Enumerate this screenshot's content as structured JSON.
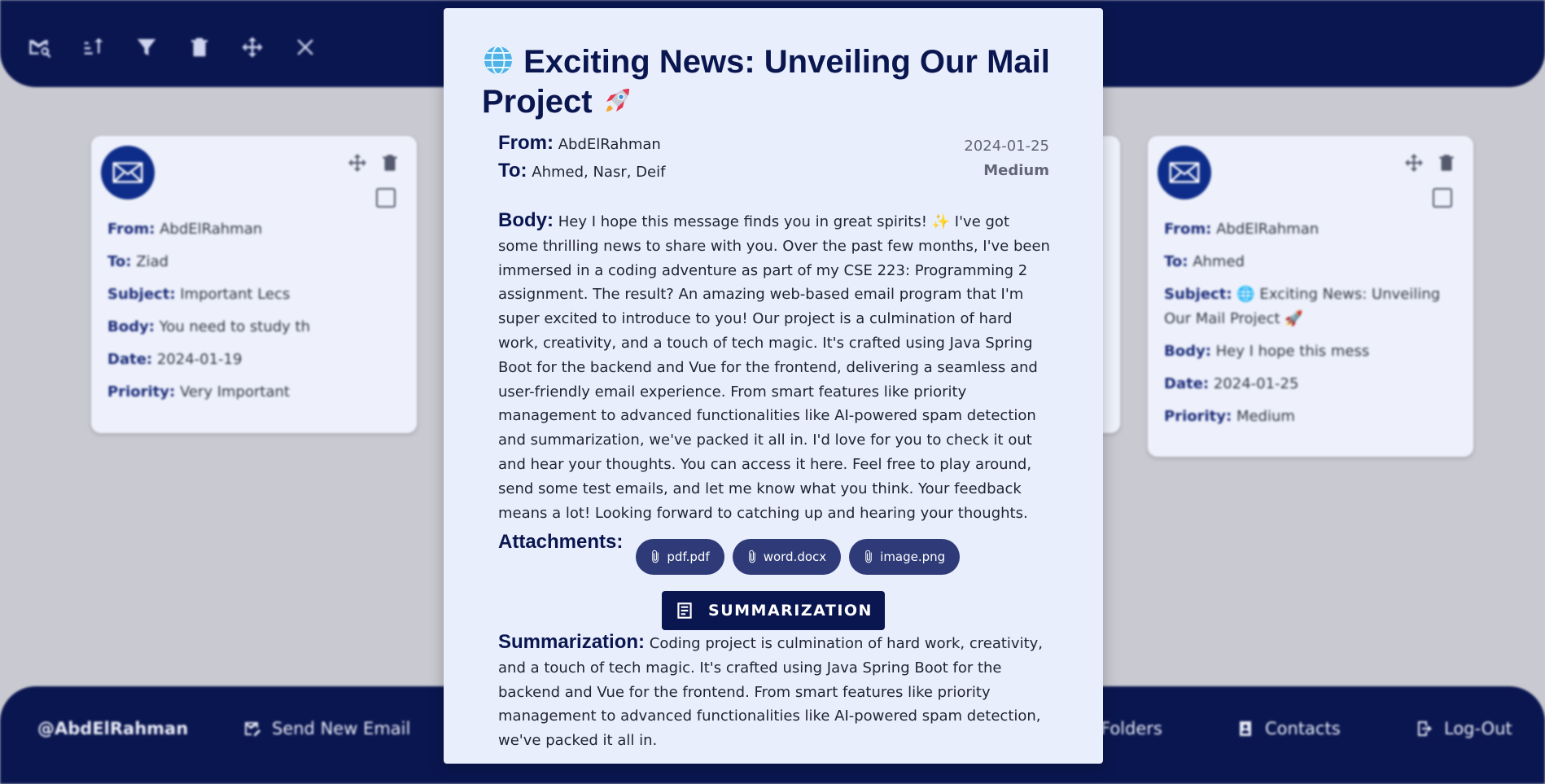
{
  "toolbar": {
    "icons": [
      "search-mail-icon",
      "sort-icon",
      "filter-icon",
      "trash-icon",
      "move-icon",
      "close-icon"
    ]
  },
  "nav": {
    "user": "@AbdElRahman",
    "send_new_email": "Send New Email",
    "folders": "Folders",
    "contacts": "Contacts",
    "logout": "Log-Out"
  },
  "labels": {
    "from": "From:",
    "to": "To:",
    "subject": "Subject:",
    "body": "Body:",
    "date": "Date:",
    "priority": "Priority:",
    "attachments": "Attachments:",
    "summarization": "Summarization:"
  },
  "cards": [
    {
      "from": "AbdElRahman",
      "to": "Ziad",
      "subject": "Important Lecs",
      "body": "You need to study th",
      "date": "2024-01-19",
      "priority": "Very Important"
    },
    {
      "from": "AbdElRahman",
      "to": "Ahmed",
      "subject": "🌐 Exciting News: Unveiling Our Mail Project 🚀",
      "body": "Hey I hope this mess",
      "date": "2024-01-25",
      "priority": "Medium"
    }
  ],
  "email": {
    "title": "🌐 Exciting News: Unveiling Our Mail Project 🚀",
    "title_emoji_start": "🌐",
    "title_text": "Exciting News: Unveiling Our Mail Project",
    "title_emoji_end": "🚀",
    "from": "AbdElRahman",
    "to": "Ahmed, Nasr, Deif",
    "date": "2024-01-25",
    "priority": "Medium",
    "body": "Hey I hope this message finds you in great spirits! ✨ I've got some thrilling news to share with you. Over the past few months, I've been immersed in a coding adventure as part of my CSE 223: Programming 2 assignment. The result? An amazing web-based email program that I'm super excited to introduce to you! Our project is a culmination of hard work, creativity, and a touch of tech magic. It's crafted using Java Spring Boot for the backend and Vue for the frontend, delivering a seamless and user-friendly email experience. From smart features like priority management to advanced functionalities like AI-powered spam detection and summarization, we've packed it all in. I'd love for you to check it out and hear your thoughts. You can access it here. Feel free to play around, send some test emails, and let me know what you think. Your feedback means a lot! Looking forward to catching up and hearing your thoughts.",
    "attachments": [
      "pdf.pdf",
      "word.docx",
      "image.png"
    ],
    "summarize_button": "SUMMARIZATION",
    "summary": "Coding project is culmination of hard work, creativity, and a touch of tech magic. It's crafted using Java Spring Boot for the backend and Vue for the frontend. From smart features like priority management to advanced functionalities like AI-powered spam detection, we've packed it all in."
  },
  "colors": {
    "navy": "#0a1650",
    "modal_bg": "#e8eefb",
    "page_bg": "#c9cad1",
    "chip": "#2e3b78"
  }
}
